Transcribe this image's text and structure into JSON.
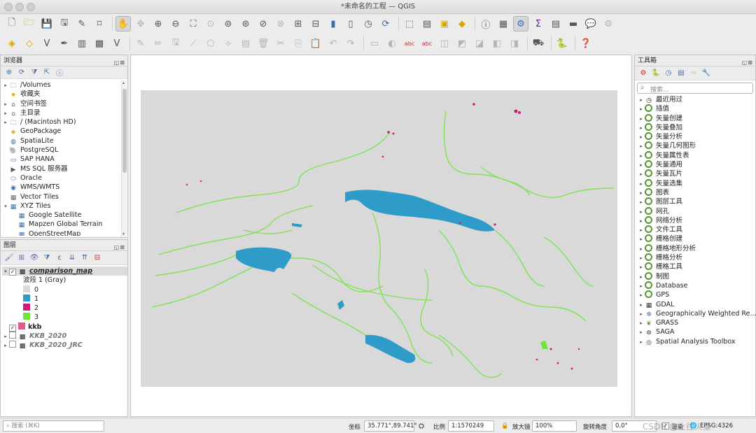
{
  "window": {
    "title": "*未命名的工程 — QGIS"
  },
  "browser": {
    "title": "浏览器",
    "items": [
      {
        "label": "/Volumes",
        "icon": "folder-icon",
        "arrow": "▸",
        "indent": 0
      },
      {
        "label": "收藏夹",
        "icon": "star-icon",
        "arrow": "",
        "indent": 0
      },
      {
        "label": "空间书签",
        "icon": "bookmark-icon",
        "arrow": "▸",
        "indent": 0
      },
      {
        "label": "主目录",
        "icon": "home-folder-icon",
        "arrow": "▸",
        "indent": 0
      },
      {
        "label": "/ (Macintosh HD)",
        "icon": "folder-icon",
        "arrow": "▸",
        "indent": 0
      },
      {
        "label": "GeoPackage",
        "icon": "geopackage-icon",
        "arrow": "",
        "indent": 0
      },
      {
        "label": "SpatiaLite",
        "icon": "spatialite-icon",
        "arrow": "",
        "indent": 0
      },
      {
        "label": "PostgreSQL",
        "icon": "postgresql-icon",
        "arrow": "",
        "indent": 0
      },
      {
        "label": "SAP HANA",
        "icon": "sap-hana-icon",
        "arrow": "",
        "indent": 0
      },
      {
        "label": "MS SQL 服务器",
        "icon": "mssql-icon",
        "arrow": "",
        "indent": 0
      },
      {
        "label": "Oracle",
        "icon": "oracle-icon",
        "arrow": "",
        "indent": 0
      },
      {
        "label": "WMS/WMTS",
        "icon": "globe-icon",
        "arrow": "",
        "indent": 0
      },
      {
        "label": "Vector Tiles",
        "icon": "vector-tiles-icon",
        "arrow": "",
        "indent": 0
      },
      {
        "label": "XYZ Tiles",
        "icon": "xyz-tiles-icon",
        "arrow": "▾",
        "indent": 0
      },
      {
        "label": "Google Satellite",
        "icon": "xyz-tiles-icon",
        "arrow": "",
        "indent": 1
      },
      {
        "label": "Mapzen Global Terrain",
        "icon": "xyz-tiles-icon",
        "arrow": "",
        "indent": 1
      },
      {
        "label": "OpenStreetMap",
        "icon": "xyz-tiles-icon",
        "arrow": "",
        "indent": 1
      }
    ]
  },
  "layers": {
    "title": "图层",
    "main_layer": "comparison_map",
    "band_label": "波段 1 (Gray)",
    "legend": [
      {
        "value": "0",
        "color": "#d9d9d9"
      },
      {
        "value": "1",
        "color": "#2f9bc9"
      },
      {
        "value": "2",
        "color": "#d01a7a"
      },
      {
        "value": "3",
        "color": "#6fe53a"
      }
    ],
    "kkb": {
      "label": "kkb",
      "color": "#e05c86"
    },
    "other": [
      "KKB_2020",
      "KKB_2020_JRC"
    ]
  },
  "toolbox": {
    "title": "工具箱",
    "search_placeholder": "搜索...",
    "recent": "最近用过",
    "items": [
      "插值",
      "矢量创建",
      "矢量叠加",
      "矢量分析",
      "矢量几何图形",
      "矢量属性表",
      "矢量通用",
      "矢量瓦片",
      "矢量选集",
      "图表",
      "图层工具",
      "网孔",
      "网络分析",
      "文件工具",
      "栅格创建",
      "栅格地形分析",
      "栅格分析",
      "栅格工具",
      "制图",
      "Database",
      "GPS"
    ],
    "extras": [
      {
        "label": "GDAL",
        "icon": "gdal-icon"
      },
      {
        "label": "Geographically Weighted Re...",
        "icon": "gwr-icon"
      },
      {
        "label": "GRASS",
        "icon": "grass-icon"
      },
      {
        "label": "SAGA",
        "icon": "saga-icon"
      },
      {
        "label": "Spatial Analysis Toolbox",
        "icon": "spatial-analysis-icon"
      }
    ]
  },
  "status": {
    "search_placeholder": "搜索 (⌘K)",
    "coord_label": "坐标",
    "coord_value": "35.771°,89.741°",
    "scale_label": "比例",
    "scale_value": "1:1570249",
    "magnifier_label": "放大镜",
    "magnifier_value": "100%",
    "rotation_label": "旋转角度",
    "rotation_value": "0.0°",
    "render_label": "渲染",
    "crs": "EPSG:4326",
    "watermark": "CSDN @土往火星"
  },
  "colors": {
    "water": "#2f9bc9",
    "land": "#d9d9d9",
    "gain": "#d01a7a",
    "loss": "#6fe53a"
  }
}
